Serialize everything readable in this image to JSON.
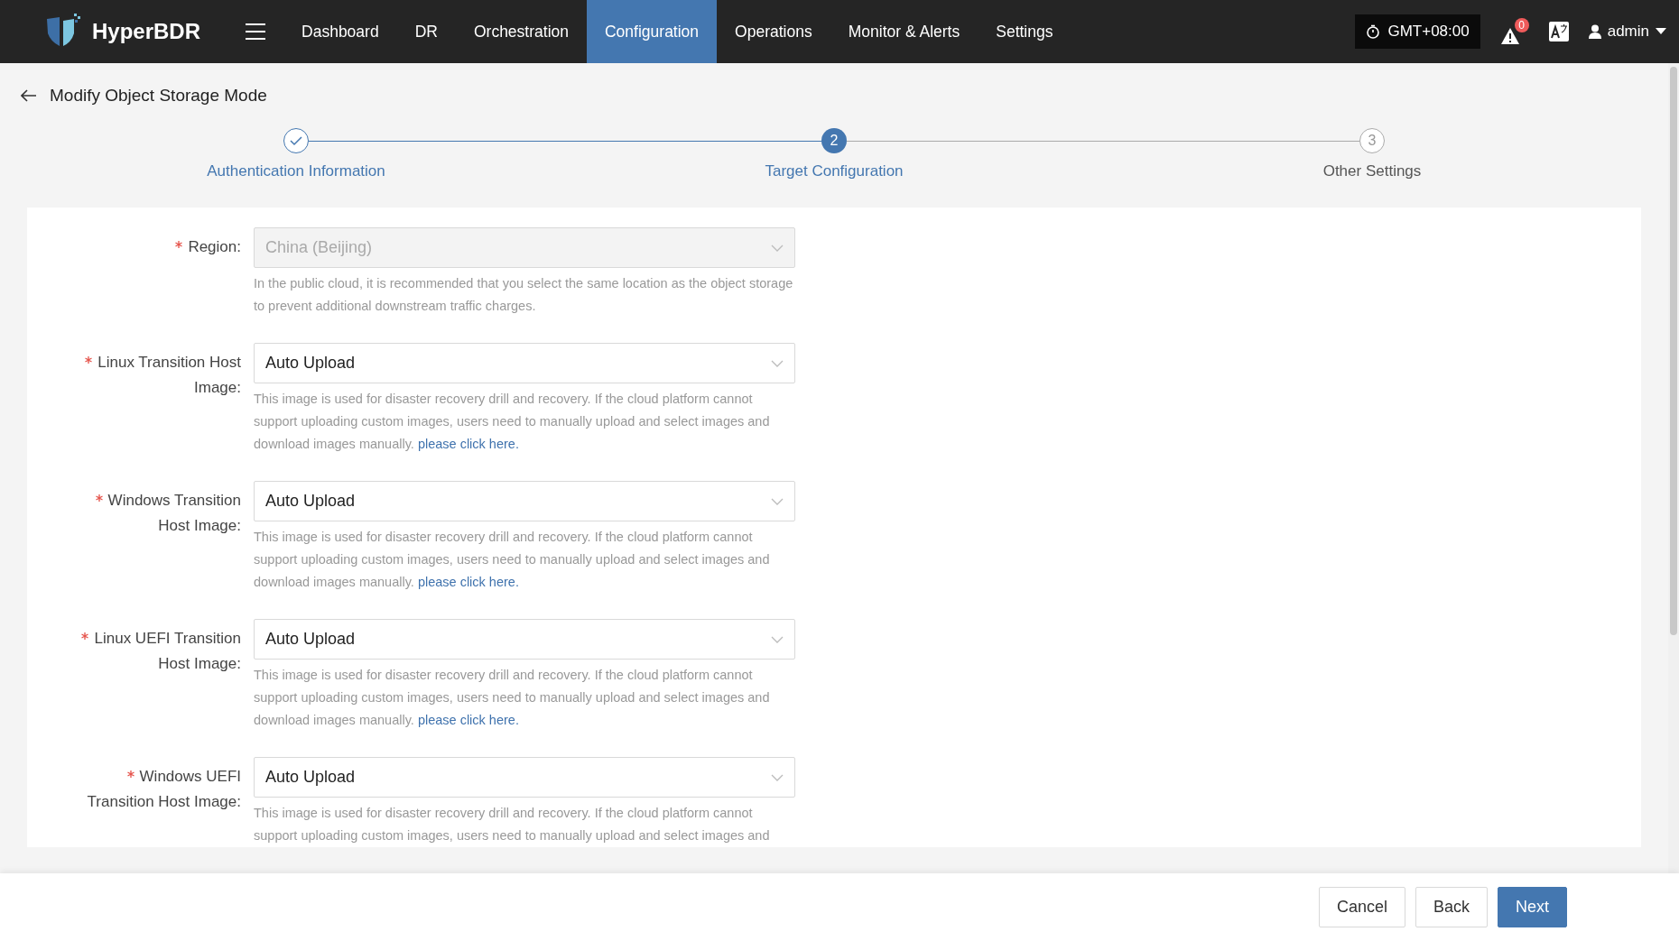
{
  "header": {
    "brand": "HyperBDR",
    "nav": [
      {
        "label": "Dashboard",
        "selected": false
      },
      {
        "label": "DR",
        "selected": false
      },
      {
        "label": "Orchestration",
        "selected": false
      },
      {
        "label": "Configuration",
        "selected": true
      },
      {
        "label": "Operations",
        "selected": false
      },
      {
        "label": "Monitor & Alerts",
        "selected": false
      },
      {
        "label": "Settings",
        "selected": false
      }
    ],
    "timezone": "GMT+08:00",
    "alert_count": "0",
    "user": "admin"
  },
  "page_title": "Modify Object Storage Mode",
  "steps": [
    {
      "label": "Authentication Information",
      "completed": true,
      "selected": false
    },
    {
      "label": "Target Configuration",
      "completed": false,
      "selected": true,
      "number": "2"
    },
    {
      "label": "Other Settings",
      "completed": false,
      "selected": false,
      "number": "3"
    }
  ],
  "form": [
    {
      "label": "Region:",
      "required": true,
      "value": "China (Beijing)",
      "disabled": true,
      "help": "In the public cloud, it is recommended that you select the same location as the object storage to prevent additional downstream traffic charges."
    },
    {
      "label": "Linux Transition Host Image:",
      "required": true,
      "value": "Auto Upload",
      "disabled": false,
      "help": "This image is used for disaster recovery drill and recovery. If the cloud platform cannot support uploading custom images, users need to manually upload and select images and download images manually.",
      "link": "please click here."
    },
    {
      "label": "Windows Transition Host Image:",
      "required": true,
      "value": "Auto Upload",
      "disabled": false,
      "help": "This image is used for disaster recovery drill and recovery. If the cloud platform cannot support uploading custom images, users need to manually upload and select images and download images manually.",
      "link": "please click here."
    },
    {
      "label": "Linux UEFI Transition Host Image:",
      "required": true,
      "value": "Auto Upload",
      "disabled": false,
      "help": "This image is used for disaster recovery drill and recovery. If the cloud platform cannot support uploading custom images, users need to manually upload and select images and download images manually.",
      "link": "please click here."
    },
    {
      "label": "Windows UEFI Transition Host Image:",
      "required": true,
      "value": "Auto Upload",
      "disabled": false,
      "help": "This image is used for disaster recovery drill and recovery. If the cloud platform cannot support uploading custom images, users need to manually upload and select images and"
    }
  ],
  "buttons": [
    {
      "label": "Cancel",
      "kind": "default"
    },
    {
      "label": "Back",
      "kind": "default"
    },
    {
      "label": "Next",
      "kind": "primary"
    }
  ]
}
